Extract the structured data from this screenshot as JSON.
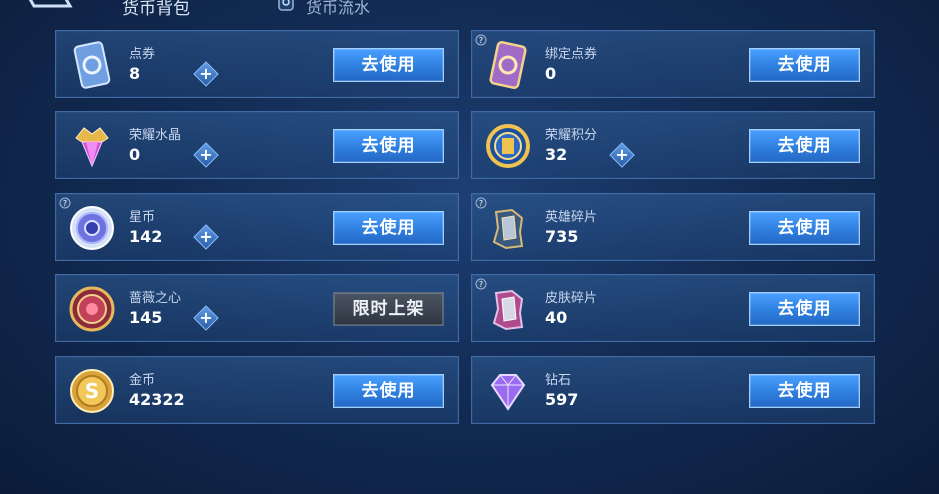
{
  "header": {
    "tab_active": "货币背包",
    "tab_flow": "货币流水"
  },
  "cards": [
    {
      "name": "点券",
      "amount": "8",
      "button": "去使用",
      "has_plus": true,
      "has_help": false,
      "icon": "voucher-card-icon"
    },
    {
      "name": "绑定点券",
      "amount": "0",
      "button": "去使用",
      "has_plus": false,
      "has_help": true,
      "icon": "bound-voucher-card-icon"
    },
    {
      "name": "荣耀水晶",
      "amount": "0",
      "button": "去使用",
      "has_plus": true,
      "has_help": false,
      "icon": "glory-crystal-icon"
    },
    {
      "name": "荣耀积分",
      "amount": "32",
      "button": "去使用",
      "has_plus": true,
      "has_help": false,
      "icon": "glory-points-coin-icon"
    },
    {
      "name": "星币",
      "amount": "142",
      "button": "去使用",
      "has_plus": true,
      "has_help": true,
      "icon": "star-coin-icon"
    },
    {
      "name": "英雄碎片",
      "amount": "735",
      "button": "去使用",
      "has_plus": false,
      "has_help": true,
      "icon": "hero-fragment-icon"
    },
    {
      "name": "蔷薇之心",
      "amount": "145",
      "button": "限时上架",
      "has_plus": true,
      "has_help": false,
      "icon": "rose-heart-coin-icon"
    },
    {
      "name": "皮肤碎片",
      "amount": "40",
      "button": "去使用",
      "has_plus": false,
      "has_help": true,
      "icon": "skin-fragment-icon"
    },
    {
      "name": "金币",
      "amount": "42322",
      "button": "去使用",
      "has_plus": false,
      "has_help": false,
      "icon": "gold-coin-icon"
    },
    {
      "name": "钻石",
      "amount": "597",
      "button": "去使用",
      "has_plus": false,
      "has_help": false,
      "icon": "diamond-icon"
    }
  ],
  "colors": {
    "button_blue": "#2f7fe0",
    "button_disabled": "#3a4450",
    "card_border": "#3f6aa3",
    "background": "#132c55"
  }
}
